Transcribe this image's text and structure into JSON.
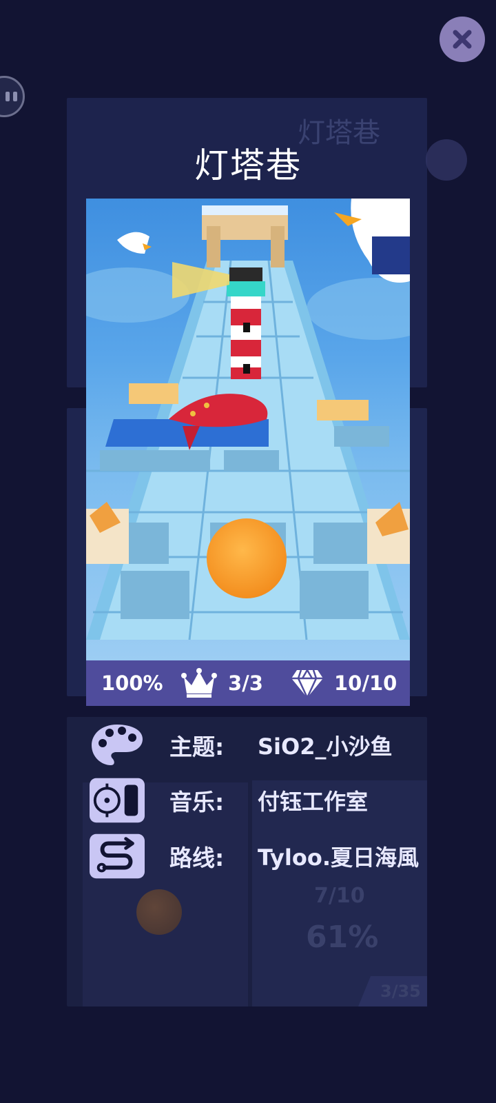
{
  "level": {
    "title": "灯塔巷",
    "ghost_title": "灯塔巷"
  },
  "stats": {
    "percent": "100%",
    "crowns": "3/3",
    "gems": "10/10"
  },
  "info": {
    "theme_label": "主题:",
    "theme_value": "SiO2_小沙鱼",
    "music_label": "音乐:",
    "music_value": "付钰工作室",
    "route_label": "路线:",
    "route_value": "Tyloo.夏日海風"
  },
  "background_ghost": {
    "gems": "7/10",
    "percent": "61%",
    "page": "3/35"
  },
  "icons": {
    "close": "close-icon",
    "pause": "pause-icon",
    "crown": "crown-icon",
    "gem": "diamond-icon",
    "palette": "palette-icon",
    "music": "speaker-icon",
    "route": "route-icon"
  },
  "colors": {
    "background": "#121433",
    "stats_bar": "#4f4c9c",
    "icon_fill": "#c9c6f4",
    "close_button": "#8a7fb8"
  }
}
